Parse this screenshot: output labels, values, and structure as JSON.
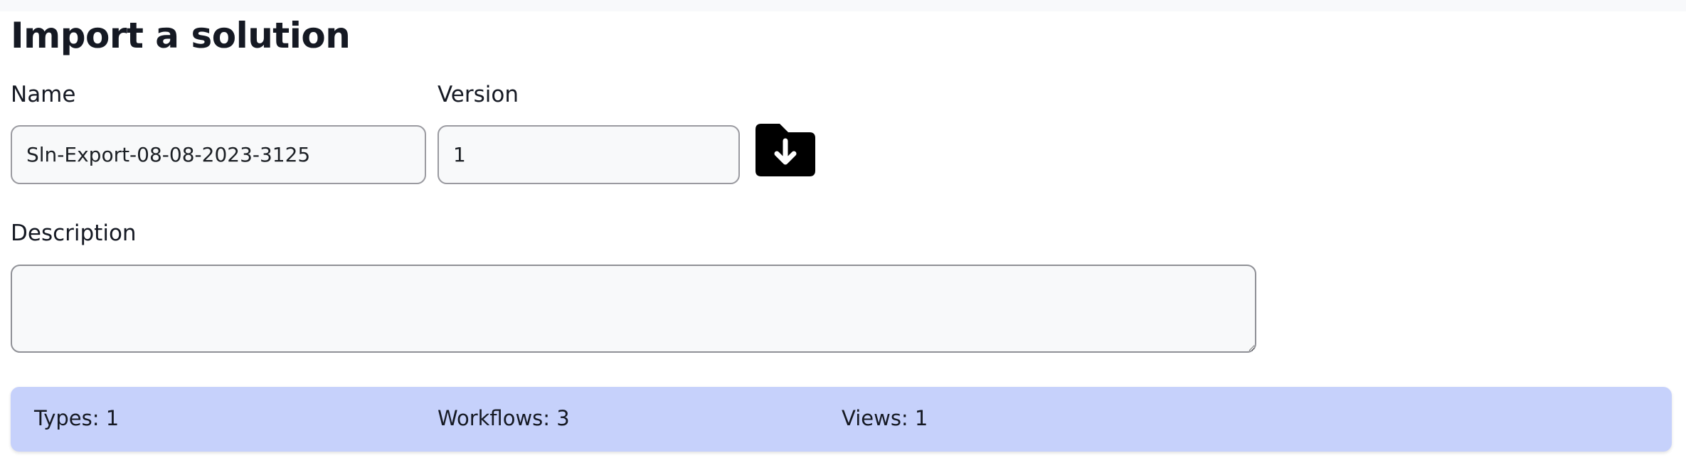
{
  "page": {
    "title": "Import a solution"
  },
  "form": {
    "name_label": "Name",
    "name_value": "Sln-Export-08-08-2023-3125",
    "version_label": "Version",
    "version_value": "1",
    "description_label": "Description",
    "description_value": "",
    "upload_icon": "folder-download-icon"
  },
  "summary": {
    "types": "Types: 1",
    "workflows": "Workflows: 3",
    "views": "Views: 1"
  },
  "colors": {
    "summary_background": "#c6d1fb",
    "input_border": "#9a9aa0",
    "text": "#151923",
    "icon": "#000000"
  }
}
